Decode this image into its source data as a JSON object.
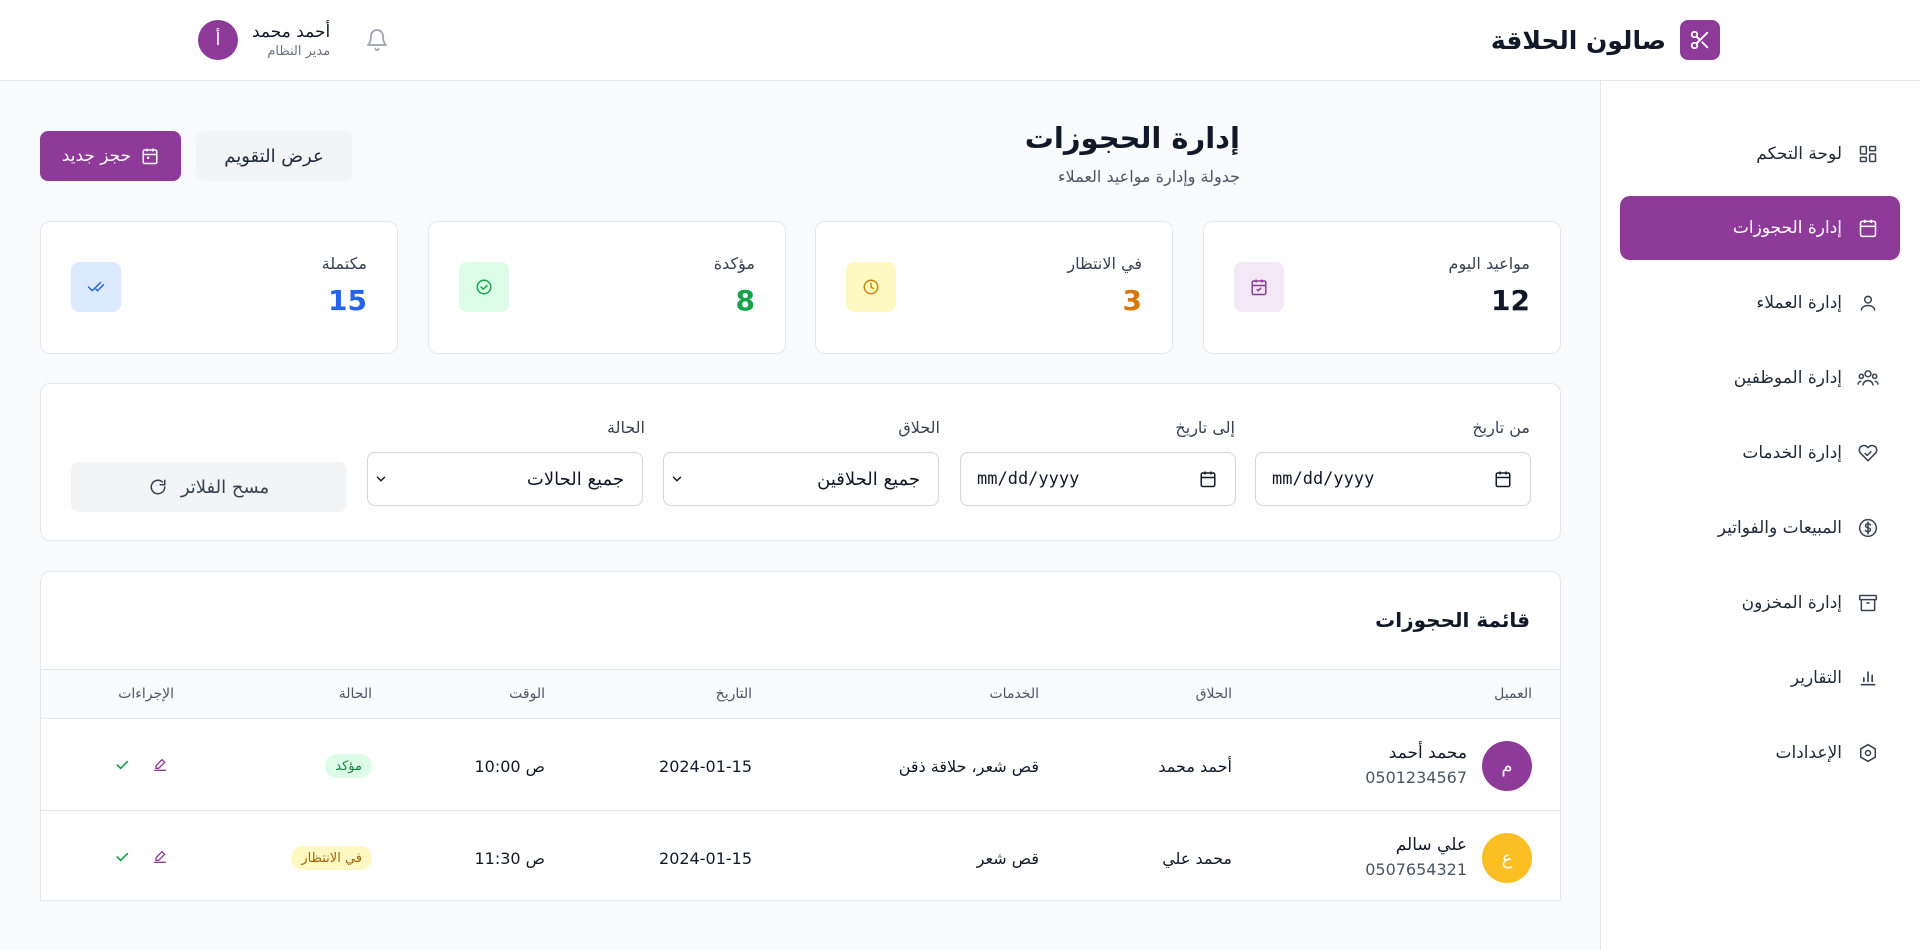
{
  "header": {
    "brand_title": "صالون الحلاقة",
    "user_name": "أحمد محمد",
    "user_role": "مدير النظام",
    "user_initial": "أ"
  },
  "sidebar": {
    "items": [
      {
        "label": "لوحة التحكم",
        "icon": "dashboard-icon"
      },
      {
        "label": "إدارة الحجوزات",
        "icon": "calendar-icon",
        "active": true
      },
      {
        "label": "إدارة العملاء",
        "icon": "user-icon"
      },
      {
        "label": "إدارة الموظفين",
        "icon": "users-icon"
      },
      {
        "label": "إدارة الخدمات",
        "icon": "heart-hand-icon"
      },
      {
        "label": "المبيعات والفواتير",
        "icon": "dollar-circle-icon"
      },
      {
        "label": "إدارة المخزون",
        "icon": "archive-icon"
      },
      {
        "label": "التقارير",
        "icon": "bar-chart-icon"
      },
      {
        "label": "الإعدادات",
        "icon": "settings-icon"
      }
    ]
  },
  "page": {
    "title": "إدارة الحجوزات",
    "subtitle": "جدولة وإدارة مواعيد العملاء",
    "new_booking_label": "حجز جديد",
    "calendar_view_label": "عرض التقويم"
  },
  "stats": [
    {
      "label": "مواعيد اليوم",
      "value": "12",
      "color": "#111827",
      "icon_bg": "#f3e8f5",
      "icon_color": "#8e3a98"
    },
    {
      "label": "في الانتظار",
      "value": "3",
      "color": "#d97706",
      "icon_bg": "#fef9c3",
      "icon_color": "#ca8a04"
    },
    {
      "label": "مؤكدة",
      "value": "8",
      "color": "#16a34a",
      "icon_bg": "#dcfce7",
      "icon_color": "#16a34a"
    },
    {
      "label": "مكتملة",
      "value": "15",
      "color": "#2563eb",
      "icon_bg": "#dbeafe",
      "icon_color": "#2563eb"
    }
  ],
  "filters": {
    "from_label": "من تاريخ",
    "to_label": "إلى تاريخ",
    "barber_label": "الحلاق",
    "status_label": "الحالة",
    "date_placeholder": "mm/dd/yyyy",
    "barber_value": "جميع الحلاقين",
    "status_value": "جميع الحالات",
    "clear_label": "مسح الفلاتر"
  },
  "table": {
    "title": "قائمة الحجوزات",
    "columns": {
      "client": "العميل",
      "barber": "الحلاق",
      "services": "الخدمات",
      "date": "التاريخ",
      "time": "الوقت",
      "status": "الحالة",
      "actions": "الإجراءات"
    },
    "rows": [
      {
        "initial": "م",
        "avatar_color": "#8e3a98",
        "client": "محمد أحمد",
        "phone": "0501234567",
        "barber": "أحمد محمد",
        "services": "قص شعر، حلاقة ذقن",
        "date": "2024-01-15",
        "time": "10:00 ص",
        "status": "مؤكد",
        "status_bg": "#dcfce7",
        "status_color": "#15803d"
      },
      {
        "initial": "ع",
        "avatar_color": "#fbbf24",
        "client": "علي سالم",
        "phone": "0507654321",
        "barber": "محمد علي",
        "services": "قص شعر",
        "date": "2024-01-15",
        "time": "11:30 ص",
        "status": "في الانتظار",
        "status_bg": "#fef9c3",
        "status_color": "#a16207"
      }
    ]
  },
  "colors": {
    "brand": "#8e3a98"
  }
}
